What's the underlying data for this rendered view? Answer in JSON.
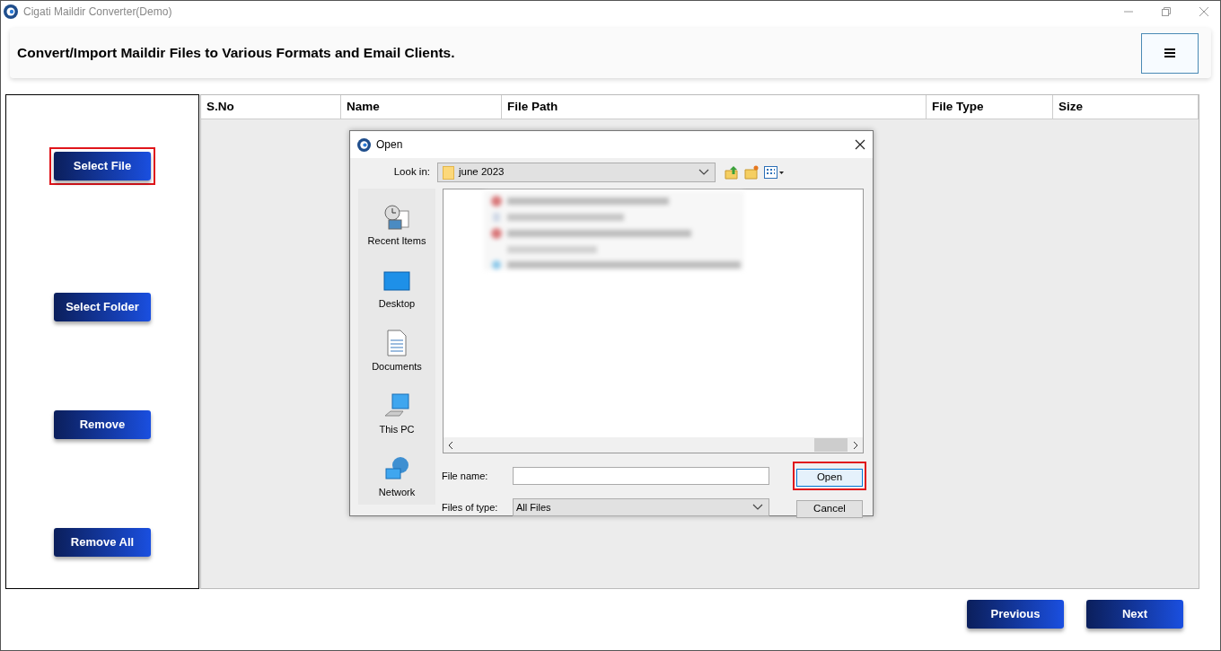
{
  "window": {
    "title": "Cigati Maildir Converter(Demo)"
  },
  "header": {
    "title": "Convert/Import Maildir Files to Various Formats and Email Clients."
  },
  "side_buttons": [
    {
      "label": "Select File",
      "highlighted": true
    },
    {
      "label": "Select Folder",
      "highlighted": false
    },
    {
      "label": "Remove",
      "highlighted": false
    },
    {
      "label": "Remove All",
      "highlighted": false
    }
  ],
  "table": {
    "columns": [
      "S.No",
      "Name",
      "File Path",
      "File Type",
      "Size"
    ]
  },
  "dialog": {
    "title": "Open",
    "look_in_label": "Look in:",
    "look_in_value": "june 2023",
    "places": [
      {
        "label": "Recent Items",
        "kind": "recent"
      },
      {
        "label": "Desktop",
        "kind": "desktop"
      },
      {
        "label": "Documents",
        "kind": "documents"
      },
      {
        "label": "This PC",
        "kind": "pc"
      },
      {
        "label": "Network",
        "kind": "network"
      }
    ],
    "file_name_label": "File name:",
    "files_of_type_label": "Files of type:",
    "files_of_type_value": "All Files",
    "buttons": [
      {
        "label": "Open",
        "highlighted": true
      },
      {
        "label": "Cancel",
        "highlighted": false
      }
    ]
  },
  "nav_buttons": [
    "Previous",
    "Next"
  ]
}
